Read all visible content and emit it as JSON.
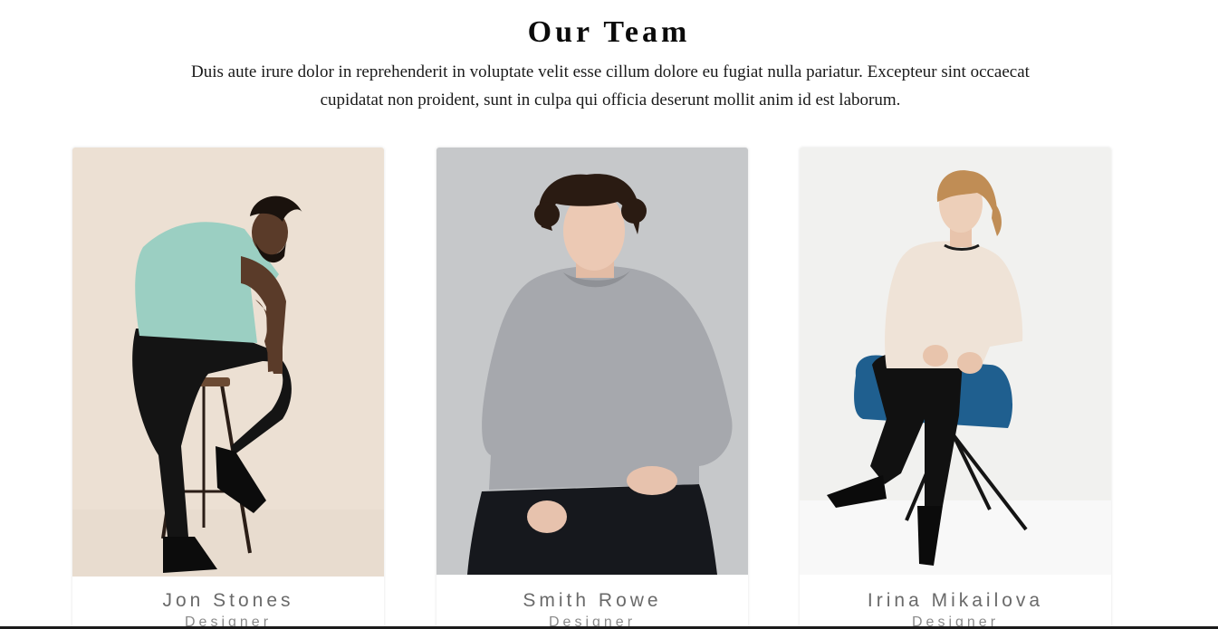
{
  "section": {
    "title": "Our Team",
    "intro": "Duis aute irure dolor in reprehenderit in voluptate velit esse cillum dolore eu fugiat nulla pariatur. Excepteur sint occaecat cupidatat non proident, sunt in culpa qui officia deserunt mollit anim id est laborum."
  },
  "members": [
    {
      "name": "Jon Stones",
      "role": "Designer"
    },
    {
      "name": "Smith Rowe",
      "role": "Designer"
    },
    {
      "name": "Irina Mikailova",
      "role": "Designer"
    }
  ],
  "colors": {
    "title": "#0b0b0b",
    "name_text": "#6a6a6a",
    "role_text": "#8a8a8a",
    "card_bg": "#ffffff"
  }
}
